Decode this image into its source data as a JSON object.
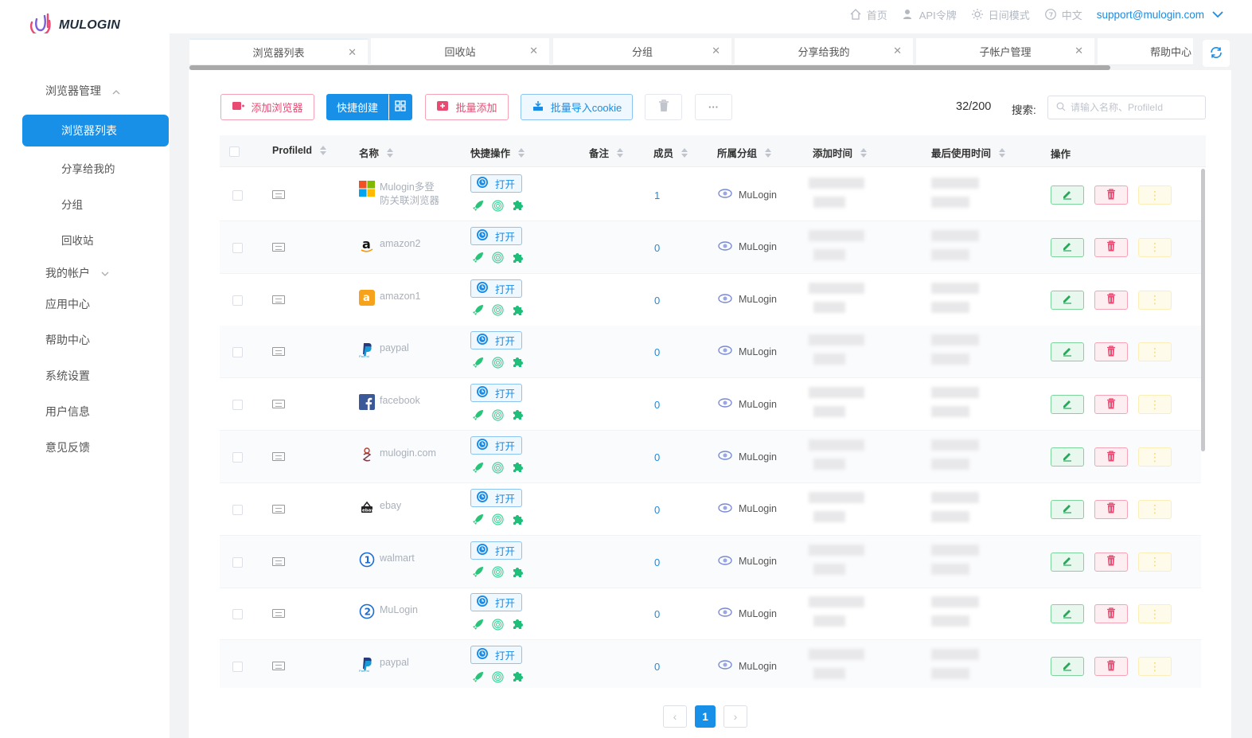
{
  "app": {
    "logo_text": "MULOGIN",
    "brand_color": "#1890e8"
  },
  "topnav": {
    "home": "首页",
    "api": "API令牌",
    "theme": "日间模式",
    "lang": "中文",
    "email": "support@mulogin.com"
  },
  "sidebar": {
    "group_browser": "浏览器管理",
    "items": [
      "浏览器列表",
      "分享给我的",
      "分组",
      "回收站"
    ],
    "group_account": "我的帐户",
    "others": [
      "应用中心",
      "帮助中心",
      "系统设置",
      "用户信息",
      "意见反馈"
    ]
  },
  "tabs": [
    {
      "label": "浏览器列表"
    },
    {
      "label": "回收站"
    },
    {
      "label": "分组"
    },
    {
      "label": "分享给我的"
    },
    {
      "label": "子帐户管理"
    },
    {
      "label": "帮助中心"
    }
  ],
  "toolbar": {
    "add_browser": "添加浏览器",
    "quick_create": "快捷创建",
    "batch_add": "批量添加",
    "import_cookie": "批量导入cookie",
    "more": "···",
    "count": "32/200",
    "search_label": "搜索:",
    "search_placeholder": "请输入名称、ProfileId"
  },
  "table": {
    "columns": [
      "ProfileId",
      "名称",
      "快捷操作",
      "备注",
      "成员",
      "所属分组",
      "添加时间",
      "最后使用时间",
      "操作"
    ],
    "open_label": "打开",
    "rows": [
      {
        "name": "Mulogin多登防关联浏览器",
        "name_line1": "Mulogin多登",
        "name_line2": "防关联浏览器",
        "icon": "windows-logo-icon",
        "members": "1",
        "group": "MuLogin"
      },
      {
        "name": "amazon2",
        "icon": "amazon-logo-icon",
        "members": "0",
        "group": "MuLogin"
      },
      {
        "name": "amazon1",
        "icon": "amazon-orange-logo-icon",
        "members": "0",
        "group": "MuLogin"
      },
      {
        "name": "paypal",
        "icon": "paypal-logo-icon",
        "members": "0",
        "group": "MuLogin"
      },
      {
        "name": "facebook",
        "icon": "facebook-logo-icon",
        "members": "0",
        "group": "MuLogin"
      },
      {
        "name": "mulogin.com",
        "icon": "mulogin-logo-icon",
        "members": "0",
        "group": "MuLogin"
      },
      {
        "name": "ebay",
        "icon": "ebay-logo-icon",
        "members": "0",
        "group": "MuLogin"
      },
      {
        "name": "walmart",
        "icon": "number-1-icon",
        "members": "0",
        "group": "MuLogin"
      },
      {
        "name": "MuLogin",
        "icon": "number-2-icon",
        "members": "0",
        "group": "MuLogin"
      },
      {
        "name": "paypal",
        "icon": "paypal-logo-icon",
        "members": "0",
        "group": "MuLogin"
      }
    ]
  },
  "pagination": {
    "current": "1",
    "prev": "‹",
    "next": "›"
  }
}
